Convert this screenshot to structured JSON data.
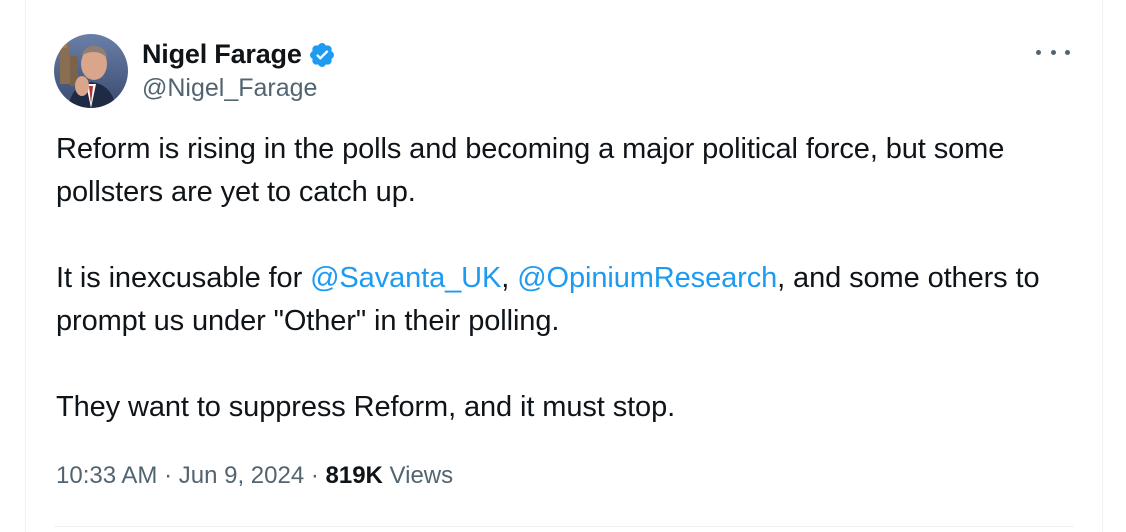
{
  "author": {
    "display_name": "Nigel Farage",
    "handle": "@Nigel_Farage",
    "verified": true
  },
  "tweet": {
    "paragraph1": "Reform is rising in the polls and becoming a major political force, but some pollsters are yet to catch up.",
    "paragraph2_prefix": "It is inexcusable for ",
    "mention1": "@Savanta_UK",
    "paragraph2_sep": ", ",
    "mention2": "@OpiniumResearch",
    "paragraph2_suffix": ", and some others to prompt us under \"Other\" in their polling.",
    "paragraph3": "They want to suppress Reform, and it must stop."
  },
  "meta": {
    "time": "10:33 AM",
    "separator": " · ",
    "date": "Jun 9, 2024",
    "views_count": "819K",
    "views_label": " Views"
  },
  "icons": {
    "more": "more-options-icon",
    "verified": "verified-badge-icon"
  },
  "colors": {
    "text": "#0f1419",
    "secondary": "#536471",
    "link": "#1d9bf0",
    "border": "#eff3f4"
  }
}
